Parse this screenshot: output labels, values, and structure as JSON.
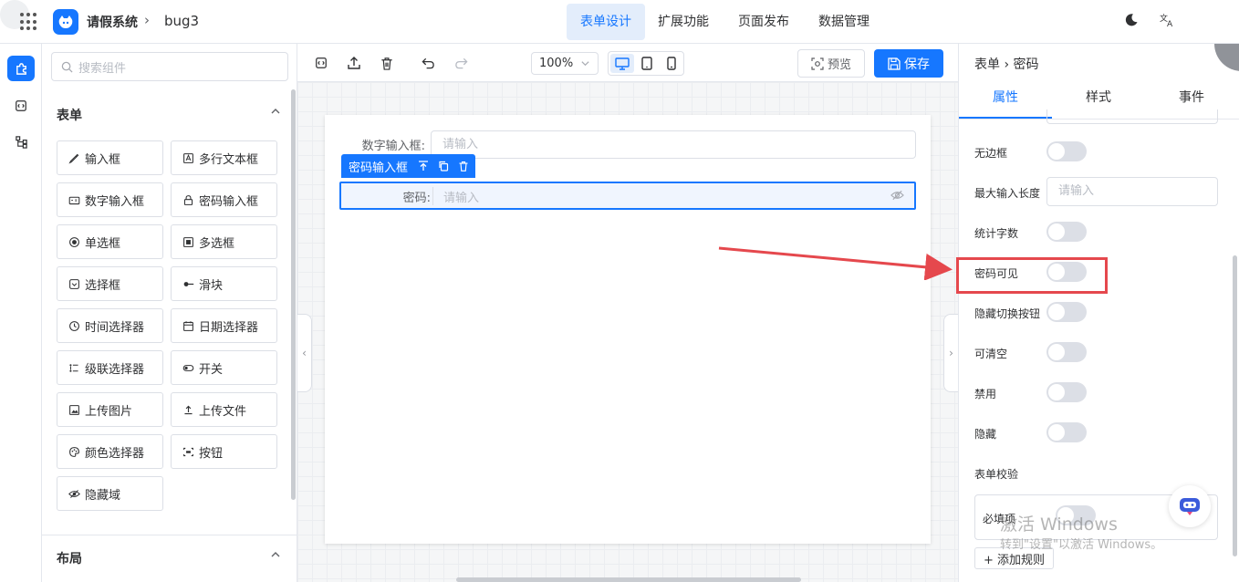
{
  "header": {
    "app_title": "请假系统",
    "crumb_sep": "›",
    "app_crumb": "bug3",
    "nav": [
      "表单设计",
      "扩展功能",
      "页面发布",
      "数据管理"
    ],
    "active_nav": "表单设计"
  },
  "components": {
    "search_placeholder": "搜索组件",
    "section_form": "表单",
    "section_layout": "布局",
    "items": [
      {
        "label": "输入框",
        "icon": "pencil-icon"
      },
      {
        "label": "多行文本框",
        "icon": "textarea-icon"
      },
      {
        "label": "数字输入框",
        "icon": "number-icon"
      },
      {
        "label": "密码输入框",
        "icon": "lock-icon"
      },
      {
        "label": "单选框",
        "icon": "radio-icon"
      },
      {
        "label": "多选框",
        "icon": "checkbox-icon"
      },
      {
        "label": "选择框",
        "icon": "select-icon"
      },
      {
        "label": "滑块",
        "icon": "slider-icon"
      },
      {
        "label": "时间选择器",
        "icon": "clock-icon"
      },
      {
        "label": "日期选择器",
        "icon": "calendar-icon"
      },
      {
        "label": "级联选择器",
        "icon": "cascader-icon"
      },
      {
        "label": "开关",
        "icon": "switch-icon"
      },
      {
        "label": "上传图片",
        "icon": "image-icon"
      },
      {
        "label": "上传文件",
        "icon": "upload-icon"
      },
      {
        "label": "颜色选择器",
        "icon": "palette-icon"
      },
      {
        "label": "按钮",
        "icon": "button-icon"
      },
      {
        "label": "隐藏域",
        "icon": "eye-off-icon"
      }
    ]
  },
  "toolbar": {
    "zoom": "100%",
    "preview_label": "预览",
    "save_label": "保存"
  },
  "canvas": {
    "field1_label": "数字输入框:",
    "field1_placeholder": "请输入",
    "selected_tag": "密码输入框",
    "field2_label": "密码:",
    "field2_placeholder": "请输入"
  },
  "props": {
    "breadcrumb": "表单 › 密码",
    "tabs": [
      "属性",
      "样式",
      "事件"
    ],
    "active_tab": "属性",
    "borderless": "无边框",
    "max_length": "最大输入长度",
    "max_length_placeholder": "请输入",
    "show_count": "统计字数",
    "show_password": "密码可见",
    "hide_toggle": "隐藏切换按钮",
    "clearable": "可清空",
    "disabled": "禁用",
    "hidden": "隐藏",
    "validation": "表单校验",
    "required": "必填项",
    "add_rule": "+ 添加规则"
  },
  "watermark": {
    "line1": "激活 Windows",
    "line2": "转到\"设置\"以激活 Windows。"
  },
  "colors": {
    "accent": "#1677ff",
    "highlight": "#e5484d"
  }
}
